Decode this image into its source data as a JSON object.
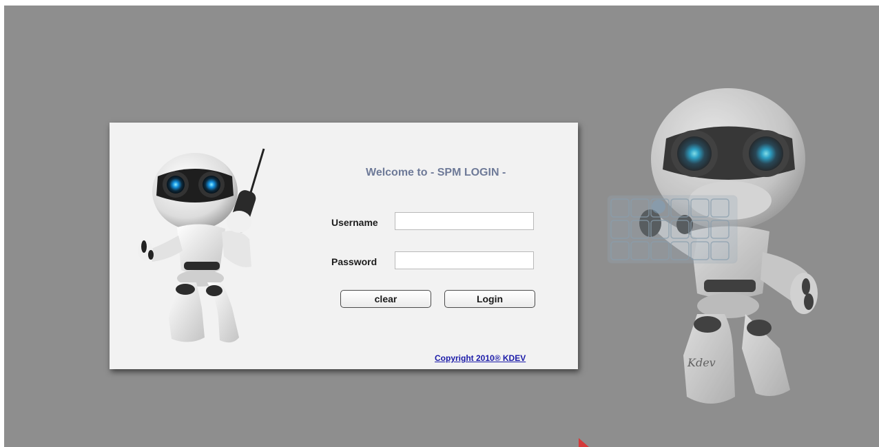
{
  "login": {
    "welcome": "Welcome to - SPM LOGIN -",
    "username_label": "Username",
    "username_value": "",
    "password_label": "Password",
    "password_value": "",
    "clear_label": "clear",
    "login_label": "Login",
    "copyright": "Copyright 2010® KDEV"
  },
  "background": {
    "robot_brand": "Kdev"
  },
  "colors": {
    "page_background": "#8e8e8e",
    "box_background": "#f2f2f2",
    "welcome_text": "#6e7a98",
    "link": "#1a1aa8",
    "cursor": "#d43a3a"
  },
  "icons": {
    "box_illustration": "robot-with-phone-icon",
    "background_illustration": "robot-touchscreen-icon"
  }
}
